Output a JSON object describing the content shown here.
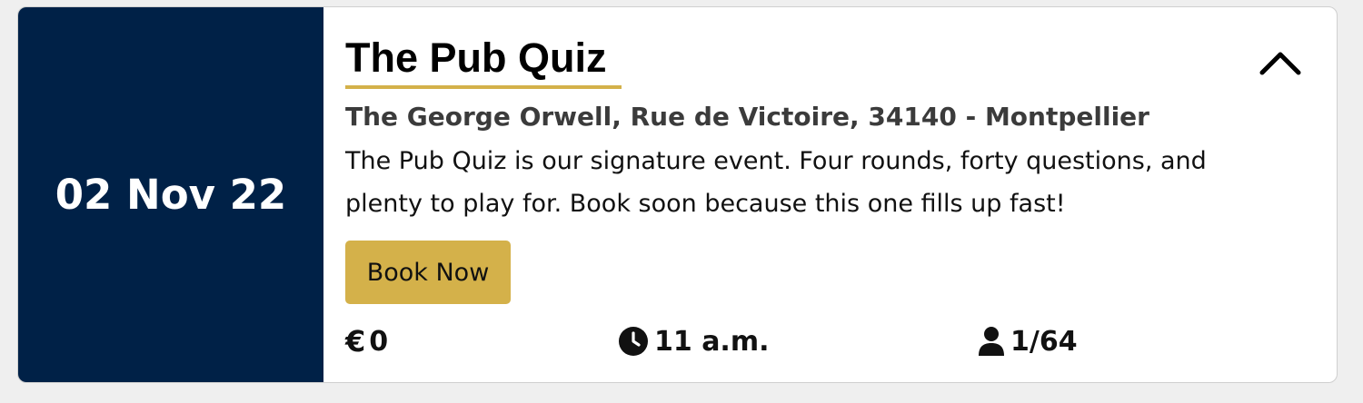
{
  "event": {
    "date": "02 Nov 22",
    "title": "The Pub Quiz",
    "address": "The George Orwell, Rue de Victoire, 34140 - Montpellier",
    "description": "The Pub Quiz is our signature event. Four rounds, forty questions, and plenty to play for. Book soon because this one fills up fast!",
    "book_label": "Book Now",
    "price": "0",
    "currency_icon": "euro-icon",
    "time": "11 a.m.",
    "time_icon": "clock-icon",
    "seats": "1/64",
    "seats_icon": "person-icon",
    "collapse_icon": "chevron-up-icon"
  },
  "colors": {
    "date_panel": "#002147",
    "accent": "#d4b14a",
    "text": "#111111",
    "address_text": "#3b3b3b"
  }
}
